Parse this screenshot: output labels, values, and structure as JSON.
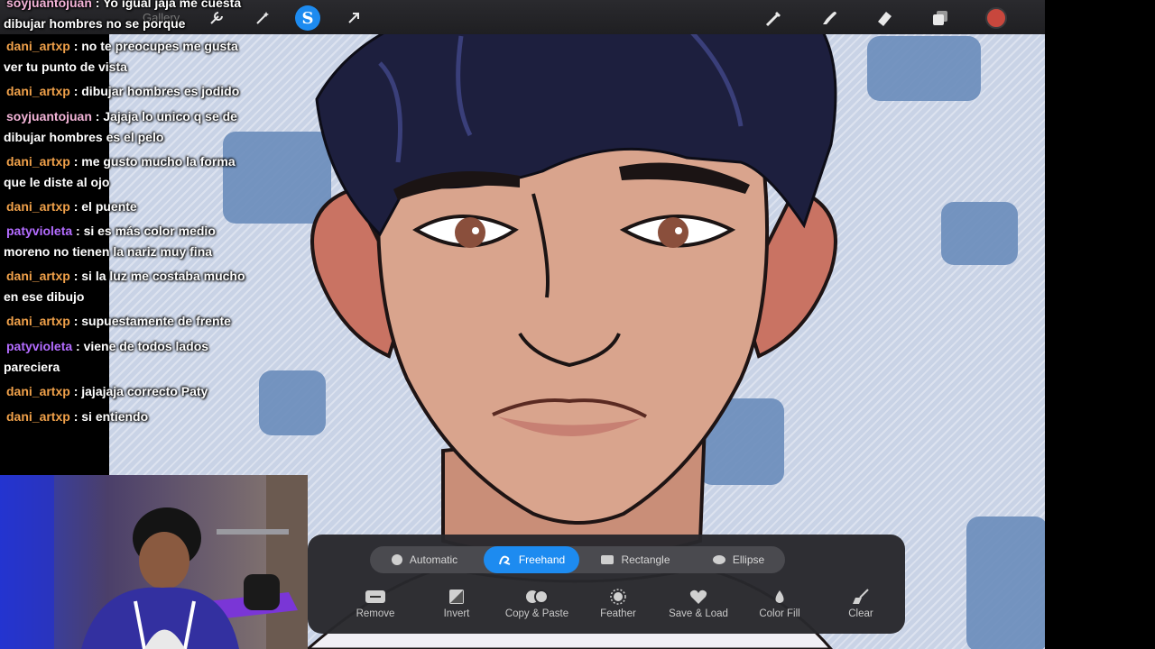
{
  "toolbar": {
    "gallery_label": "Gallery",
    "icons": [
      "wrench-icon",
      "magic-wand-icon",
      "smudge-s-icon",
      "selection-arrow-icon",
      "brush-icon",
      "smudge-icon",
      "eraser-icon",
      "layers-icon"
    ],
    "color": "#c8473d"
  },
  "chat": [
    {
      "user": "soyjuantojuan",
      "color": "pink",
      "text": ": Yo igual jaja me cuesta dibujar hombres no se porque"
    },
    {
      "user": "dani_artxp",
      "color": "orange",
      "text": ": no te preocupes me gusta ver tu punto de vista"
    },
    {
      "user": "dani_artxp",
      "color": "orange",
      "text": ": dibujar hombres es jodido"
    },
    {
      "user": "soyjuantojuan",
      "color": "pink",
      "text": ": Jajaja lo unico q se de dibujar hombres es el pelo"
    },
    {
      "user": "dani_artxp",
      "color": "orange",
      "text": ": me gusto mucho la forma que le diste al ojo"
    },
    {
      "user": "dani_artxp",
      "color": "orange",
      "text": ": el puente"
    },
    {
      "user": "patyvioleta",
      "color": "purple",
      "text": ": si es más color medio moreno no tienen la nariz muy fina"
    },
    {
      "user": "dani_artxp",
      "color": "orange",
      "text": ": si la luz me costaba mucho en ese dibujo"
    },
    {
      "user": "dani_artxp",
      "color": "orange",
      "text": ": supuestamente de frente"
    },
    {
      "user": "patyvioleta",
      "color": "purple",
      "text": ": viene de todos lados pareciera"
    },
    {
      "user": "dani_artxp",
      "color": "orange",
      "text": ": jajajaja correcto Paty"
    },
    {
      "user": "dani_artxp",
      "color": "orange",
      "text": ": si entiendo"
    }
  ],
  "selection": {
    "modes": [
      {
        "label": "Automatic",
        "icon": "automatic-icon",
        "active": false
      },
      {
        "label": "Freehand",
        "icon": "freehand-icon",
        "active": true
      },
      {
        "label": "Rectangle",
        "icon": "rectangle-icon",
        "active": false
      },
      {
        "label": "Ellipse",
        "icon": "ellipse-icon",
        "active": false
      }
    ],
    "tools": [
      {
        "label": "Remove",
        "icon": "remove-icon"
      },
      {
        "label": "Invert",
        "icon": "invert-icon"
      },
      {
        "label": "Copy & Paste",
        "icon": "copy-paste-icon"
      },
      {
        "label": "Feather",
        "icon": "feather-icon"
      },
      {
        "label": "Save & Load",
        "icon": "heart-icon"
      },
      {
        "label": "Color Fill",
        "icon": "color-fill-icon"
      },
      {
        "label": "Clear",
        "icon": "clear-icon"
      }
    ]
  }
}
